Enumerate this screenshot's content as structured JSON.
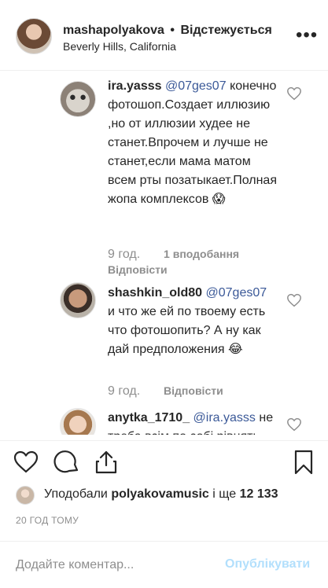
{
  "header": {
    "username": "mashapolyakova",
    "separator": "•",
    "follow_status": "Відстежується",
    "location": "Beverly Hills, California",
    "more_label": "•••"
  },
  "comments": [
    {
      "username": "ira.yasss",
      "mention": "@07ges07",
      "text": "конечно фотошоп.Создает иллюзию ,но от иллюзии худее не станет.Впрочем и лучше не станет,если мама матом всем рты позатыкает.Полная жопа комплексов 😱",
      "time": "9 год.",
      "likes": "1 вподобання",
      "reply": "Відповісти",
      "avatar_icon": "cat-avatar"
    },
    {
      "username": "shashkin_old80",
      "mention": "@07ges07",
      "text": "и что же ей по твоему есть что фотошопить? А ну как дай предположения 😂",
      "time": "9 год.",
      "reply": "Відповісти",
      "avatar_icon": "man-avatar"
    },
    {
      "username": "anytka_1710_",
      "mention": "@ira.yasss",
      "text": "не треба всім по собі рівнять",
      "avatar_icon": "girl-avatar"
    }
  ],
  "actions": {
    "like_icon": "heart-icon",
    "comment_icon": "comment-icon",
    "share_icon": "share-icon",
    "save_icon": "bookmark-icon"
  },
  "likes": {
    "prefix": "Уподобали",
    "user": "polyakovamusic",
    "middle": "і ще",
    "count": "12 133"
  },
  "timestamp": "20 ГОД ТОМУ",
  "add_comment": {
    "placeholder": "Додайте коментар...",
    "post_label": "Опублікувати"
  },
  "colors": {
    "mention": "#3b5998",
    "post_disabled": "#b2dffc",
    "meta": "#8e8e8e"
  }
}
